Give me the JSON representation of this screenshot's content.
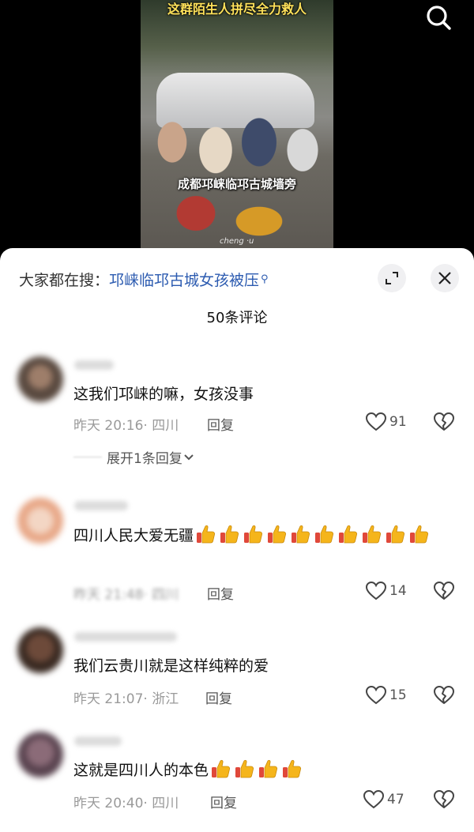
{
  "video": {
    "title_overlay": "这群陌生人拼尽全力救人",
    "caption": "成都邛崃临邛古城墙旁",
    "watermark": "cheng ·u"
  },
  "icons": {
    "search": "search-icon",
    "expand": "expand-icon",
    "close": "close-icon",
    "heart": "heart-icon",
    "dislike": "broken-heart-icon",
    "thumbs_up": "thumbs-up-emoji",
    "chevron": "chevron-down-icon"
  },
  "colors": {
    "link": "#2c5bb0",
    "meta": "#9a9a9a",
    "thumb": "#f5b51b"
  },
  "comments_panel": {
    "search_prefix": "大家都在搜：",
    "search_term": "邛崃临邛古城女孩被压",
    "count_title": "50条评论",
    "comments": [
      {
        "text": "这我们邛崃的嘛，女孩没事",
        "time": "昨天 20:16",
        "location": "· 四川",
        "reply": "回复",
        "likes": "91",
        "expand_replies": "展开1条回复"
      },
      {
        "text_line1": "四川人民大爱无疆",
        "emoji_count": 10,
        "time": "昨天 21:48",
        "location": "· 四川",
        "reply": "回复",
        "likes": "14"
      },
      {
        "text": "我们云贵川就是这样纯粹的爱",
        "time": "昨天 21:07",
        "location": "· 浙江",
        "reply": "回复",
        "likes": "15"
      },
      {
        "text": "这就是四川人的本色",
        "emoji_count": 4,
        "time": "昨天 20:40",
        "location": "· 四川",
        "reply": "回复",
        "likes": "47"
      }
    ]
  }
}
